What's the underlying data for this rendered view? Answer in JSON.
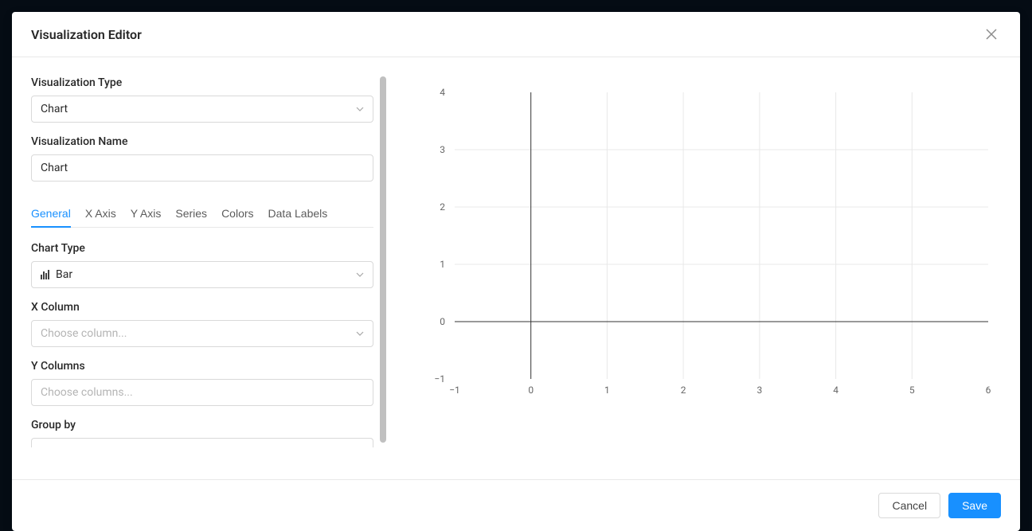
{
  "modal": {
    "title": "Visualization Editor"
  },
  "form": {
    "viz_type_label": "Visualization Type",
    "viz_type_value": "Chart",
    "viz_name_label": "Visualization Name",
    "viz_name_value": "Chart",
    "chart_type_label": "Chart Type",
    "chart_type_value": "Bar",
    "x_column_label": "X Column",
    "x_column_placeholder": "Choose column...",
    "y_columns_label": "Y Columns",
    "y_columns_placeholder": "Choose columns...",
    "group_by_label": "Group by"
  },
  "tabs": {
    "general": "General",
    "x_axis": "X Axis",
    "y_axis": "Y Axis",
    "series": "Series",
    "colors": "Colors",
    "data_labels": "Data Labels"
  },
  "chart_data": {
    "type": "bar",
    "categories": [],
    "values": [],
    "title": "",
    "xlabel": "",
    "ylabel": "",
    "xlim": [
      -1,
      6
    ],
    "ylim": [
      -1,
      4
    ],
    "x_ticks": [
      -1,
      0,
      1,
      2,
      3,
      4,
      5,
      6
    ],
    "y_ticks": [
      -1,
      0,
      1,
      2,
      3,
      4
    ]
  },
  "footer": {
    "cancel_label": "Cancel",
    "save_label": "Save"
  }
}
